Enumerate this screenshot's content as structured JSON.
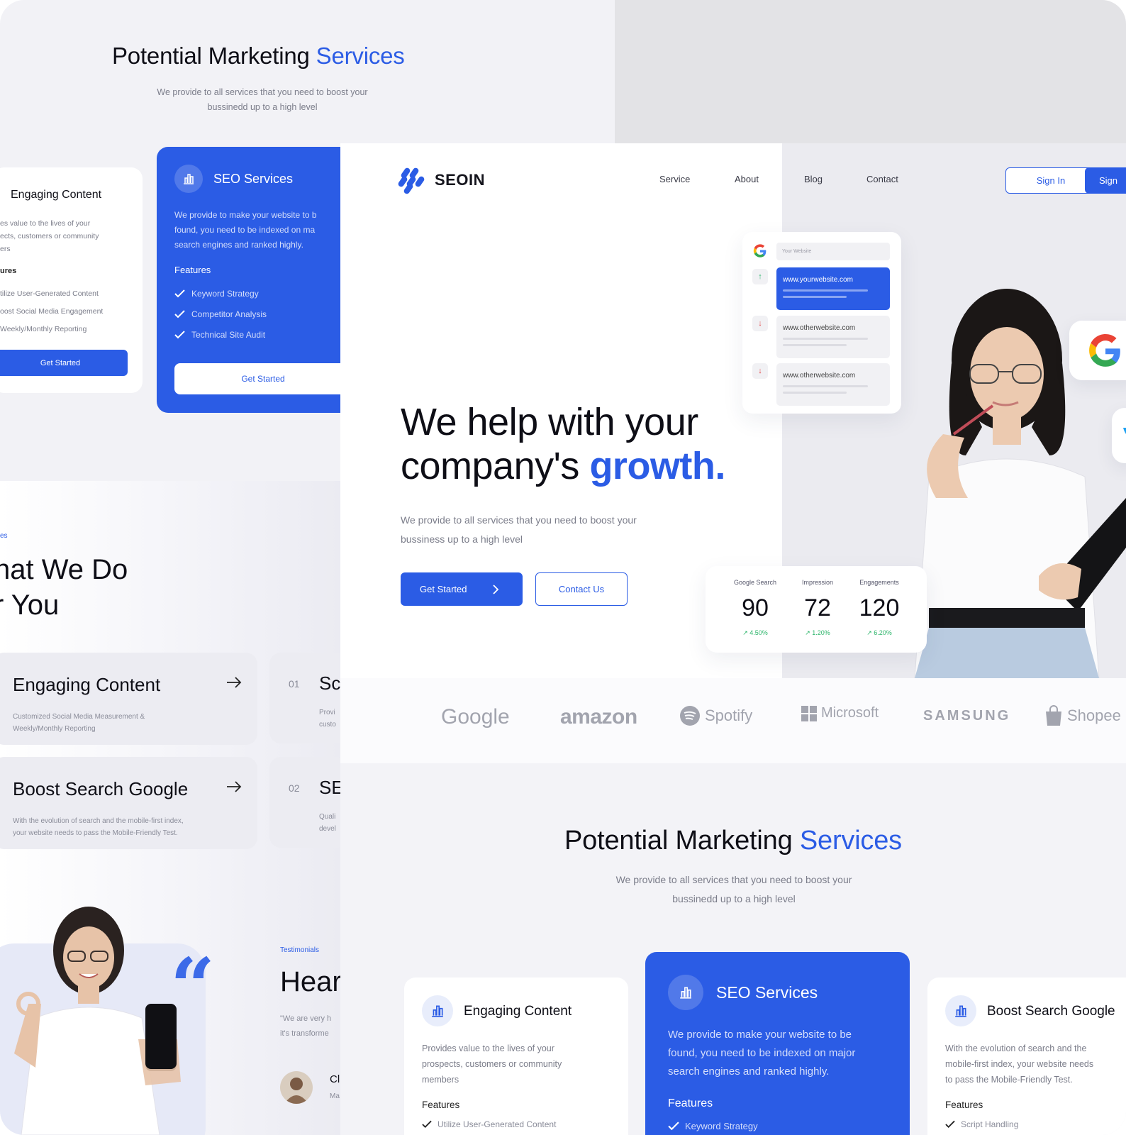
{
  "bg_page": {
    "title_pre": "Potential Marketing ",
    "title_accent": "Services",
    "subtitle": "We provide to all services that you need to boost your bussinedd up to a high level",
    "card_engaging": {
      "title": "Engaging Content",
      "desc": "es value to the lives of your\nects, customers or community\ners",
      "features_label": "ures",
      "features": "tilize User-Generated Content\noost Social Media Engagement\nWeekly/Monthly Reporting",
      "button": "Get Started"
    },
    "card_seo": {
      "title": "SEO Services",
      "desc": "We provide to make your website to b\nfound, you need to be indexed on ma\nsearch engines and ranked highly.",
      "features_label": "Features",
      "features": [
        "Keyword Strategy",
        "Competitor Analysis",
        "Technical Site Audit"
      ],
      "button": "Get Started"
    },
    "what_we_do": {
      "tag": "es",
      "title": "hat We Do\nr You",
      "cards": [
        {
          "title": "Engaging Content",
          "desc": "Customized Social Media Measurement &\nWeekly/Monthly Reporting"
        },
        {
          "title": "Boost Search Google",
          "desc": "With the evolution of search and the mobile-first index,\nyour website needs to pass the Mobile-Friendly Test."
        }
      ],
      "numbered": [
        {
          "num": "01",
          "title": "Sc",
          "desc": "Provi\ncusto"
        },
        {
          "num": "02",
          "title": "SE",
          "desc": "Quali\ndevel"
        }
      ]
    },
    "testimonials": {
      "tag": "Testimonials",
      "title": "Hear",
      "text": "\"We are very h\nit's transforme",
      "name": "Cl",
      "role": "Ma"
    }
  },
  "nav": {
    "brand": "SEOIN",
    "links": [
      "Service",
      "About",
      "Blog",
      "Contact"
    ],
    "signin": "Sign In",
    "signup": "Sign"
  },
  "hero": {
    "line1": "We help with your",
    "line2_pre": "company's ",
    "line2_accent": "growth.",
    "subtitle": "We provide to all services that you need to boost your bussiness up to a high level",
    "cta_primary": "Get Started",
    "cta_secondary": "Contact Us"
  },
  "serp": {
    "search_placeholder": "Your Website",
    "results": [
      "www.yourwebsite.com",
      "www.otherwebsite.com",
      "www.otherwebsite.com"
    ]
  },
  "stats": [
    {
      "label": "Google Search",
      "value": "90",
      "change": "4.50%"
    },
    {
      "label": "Impression",
      "value": "72",
      "change": "1.20%"
    },
    {
      "label": "Engagements",
      "value": "120",
      "change": "6.20%"
    }
  ],
  "brands": [
    "Google",
    "amazon",
    "Spotify",
    "Microsoft",
    "SAMSUNG",
    "Shopee"
  ],
  "marketing": {
    "title_pre": "Potential Marketing ",
    "title_accent": "Services",
    "subtitle": "We provide to all services that you need to boost your bussinedd up to a high level",
    "cards": [
      {
        "title": "Engaging Content",
        "desc": "Provides value to the lives of your\nprospects, customers or community\nmembers",
        "features_label": "Features",
        "first_feature": "Utilize User-Generated Content"
      },
      {
        "title": "SEO Services",
        "desc": "We provide to make your website to be\nfound, you need to be indexed on major\nsearch engines and ranked highly.",
        "features_label": "Features",
        "first_feature": "Keyword Strategy"
      },
      {
        "title": "Boost Search Google",
        "desc": "With the evolution of search and the\nmobile-first index, your website needs\nto pass the Mobile-Friendly Test.",
        "features_label": "Features",
        "first_feature": "Script Handling"
      }
    ]
  },
  "colors": {
    "accent": "#2b5ce5",
    "positive": "#2cb56a",
    "background": "#f2f2f6"
  },
  "icons": [
    "chart-icon",
    "check-icon",
    "arrow-right-icon",
    "chevron-right-icon",
    "google-icon",
    "quote-icon"
  ]
}
